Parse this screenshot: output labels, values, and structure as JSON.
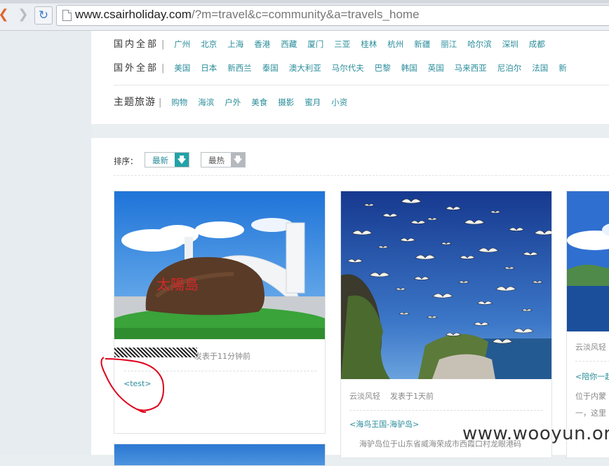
{
  "browser": {
    "url_host": "www.csairholiday.com",
    "url_path": "/?m=travel&c=community&a=travels_home"
  },
  "destinations": {
    "domestic_label": "国内全部",
    "domestic": [
      "广州",
      "北京",
      "上海",
      "香港",
      "西藏",
      "厦门",
      "三亚",
      "桂林",
      "杭州",
      "新疆",
      "丽江",
      "哈尔滨",
      "深圳",
      "成都"
    ],
    "foreign_label": "国外全部",
    "foreign": [
      "美国",
      "日本",
      "新西兰",
      "泰国",
      "澳大利亚",
      "马尔代夫",
      "巴黎",
      "韩国",
      "英国",
      "马来西亚",
      "尼泊尔",
      "法国",
      "新"
    ],
    "theme_label": "主题旅游",
    "themes": [
      "购物",
      "海滨",
      "户外",
      "美食",
      "摄影",
      "蜜月",
      "小资"
    ]
  },
  "sort": {
    "label": "排序：",
    "newest": "最新",
    "hottest": "最热"
  },
  "cards": [
    {
      "author": "",
      "time": "发表于11分钟前",
      "title": "<test>",
      "desc": ""
    },
    {
      "author": "云淡风轻",
      "time": "发表于1天前",
      "title": "<海鸟王国-海驴岛>",
      "desc": "海驴岛位于山东省威海荣成市西霞口村龙眼港码"
    },
    {
      "author": "云淡风轻",
      "time": "",
      "title": "<陪你一起",
      "desc": "位于内蒙",
      "desc2": "一，这里"
    }
  ],
  "card1_image_text": "太陽島",
  "watermark": "www.wooyun.org",
  "colors": {
    "link": "#2a8d9b",
    "accent_button": "#22a2a8",
    "annotation": "#e0001c"
  }
}
